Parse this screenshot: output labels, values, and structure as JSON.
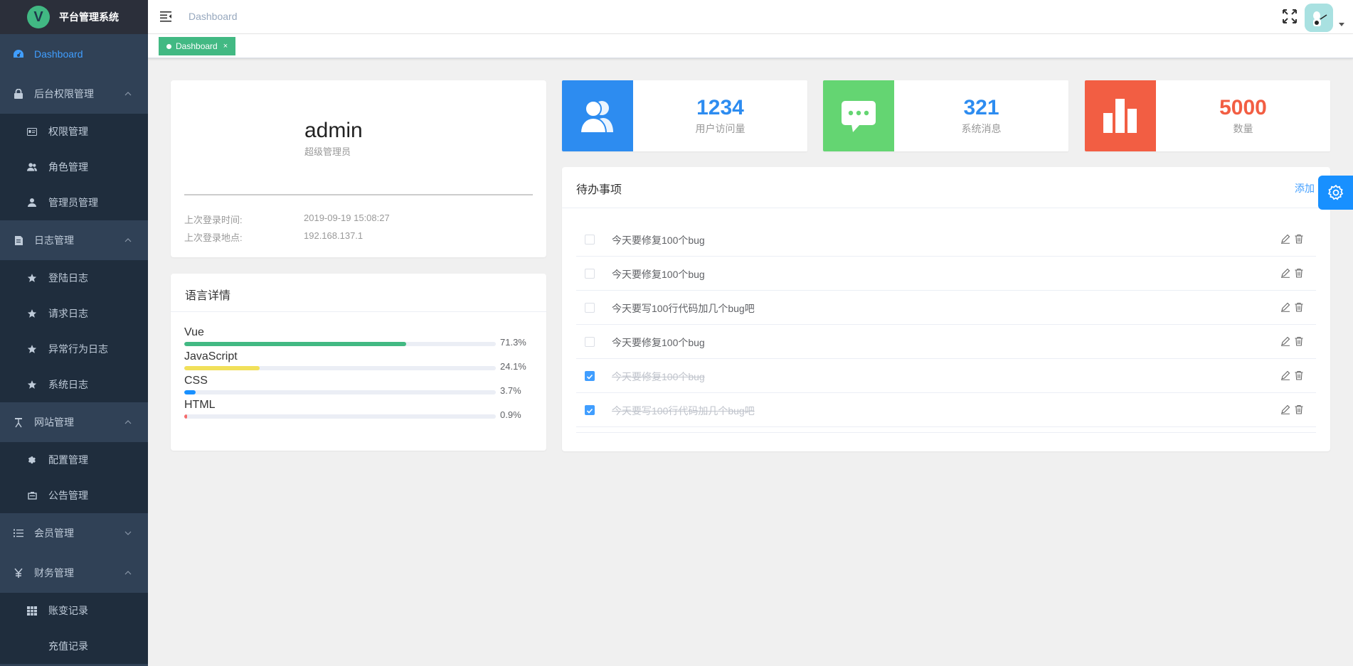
{
  "app": {
    "title": "平台管理系统",
    "logo_letter": "V"
  },
  "sidebar": {
    "dashboard": "Dashboard",
    "groups": [
      {
        "label": "后台权限管理",
        "items": [
          "权限管理",
          "角色管理",
          "管理员管理"
        ]
      },
      {
        "label": "日志管理",
        "items": [
          "登陆日志",
          "请求日志",
          "异常行为日志",
          "系统日志"
        ]
      },
      {
        "label": "网站管理",
        "items": [
          "配置管理",
          "公告管理"
        ]
      },
      {
        "label": "会员管理",
        "items": []
      },
      {
        "label": "财务管理",
        "items": [
          "账变记录",
          "充值记录"
        ]
      }
    ]
  },
  "navbar": {
    "breadcrumb": "Dashboard"
  },
  "tags": {
    "active": "Dashboard",
    "close": "×"
  },
  "user": {
    "name": "admin",
    "role": "超级管理员",
    "last_login_time_label": "上次登录时间:",
    "last_login_time": "2019-09-19 15:08:27",
    "last_login_location_label": "上次登录地点:",
    "last_login_location": "192.168.137.1"
  },
  "languages": {
    "title": "语言详情",
    "items": [
      {
        "name": "Vue",
        "pct": "71.3%",
        "value": 71.3,
        "color": "#42b983"
      },
      {
        "name": "JavaScript",
        "pct": "24.1%",
        "value": 24.1,
        "color": "#f1e05a"
      },
      {
        "name": "CSS",
        "pct": "3.7%",
        "value": 3.7,
        "color": "#1890ff"
      },
      {
        "name": "HTML",
        "pct": "0.9%",
        "value": 0.9,
        "color": "#f56c6c"
      }
    ]
  },
  "stats": [
    {
      "value": "1234",
      "label": "用户访问量",
      "color": "#2d8cf0",
      "icon": "users-icon"
    },
    {
      "value": "321",
      "label": "系统消息",
      "color": "#64d572",
      "icon": "message-icon"
    },
    {
      "value": "5000",
      "label": "数量",
      "color": "#f25e43",
      "icon": "bar-chart-icon"
    }
  ],
  "todo": {
    "title": "待办事项",
    "add": "添加",
    "items": [
      {
        "text": "今天要修复100个bug",
        "done": false
      },
      {
        "text": "今天要修复100个bug",
        "done": false
      },
      {
        "text": "今天要写100行代码加几个bug吧",
        "done": false
      },
      {
        "text": "今天要修复100个bug",
        "done": false
      },
      {
        "text": "今天要修复100个bug",
        "done": true
      },
      {
        "text": "今天要写100行代码加几个bug吧",
        "done": true
      }
    ]
  },
  "colors": {
    "sidebar_bg": "#304156",
    "accent": "#409eff",
    "tag": "#42b983"
  }
}
